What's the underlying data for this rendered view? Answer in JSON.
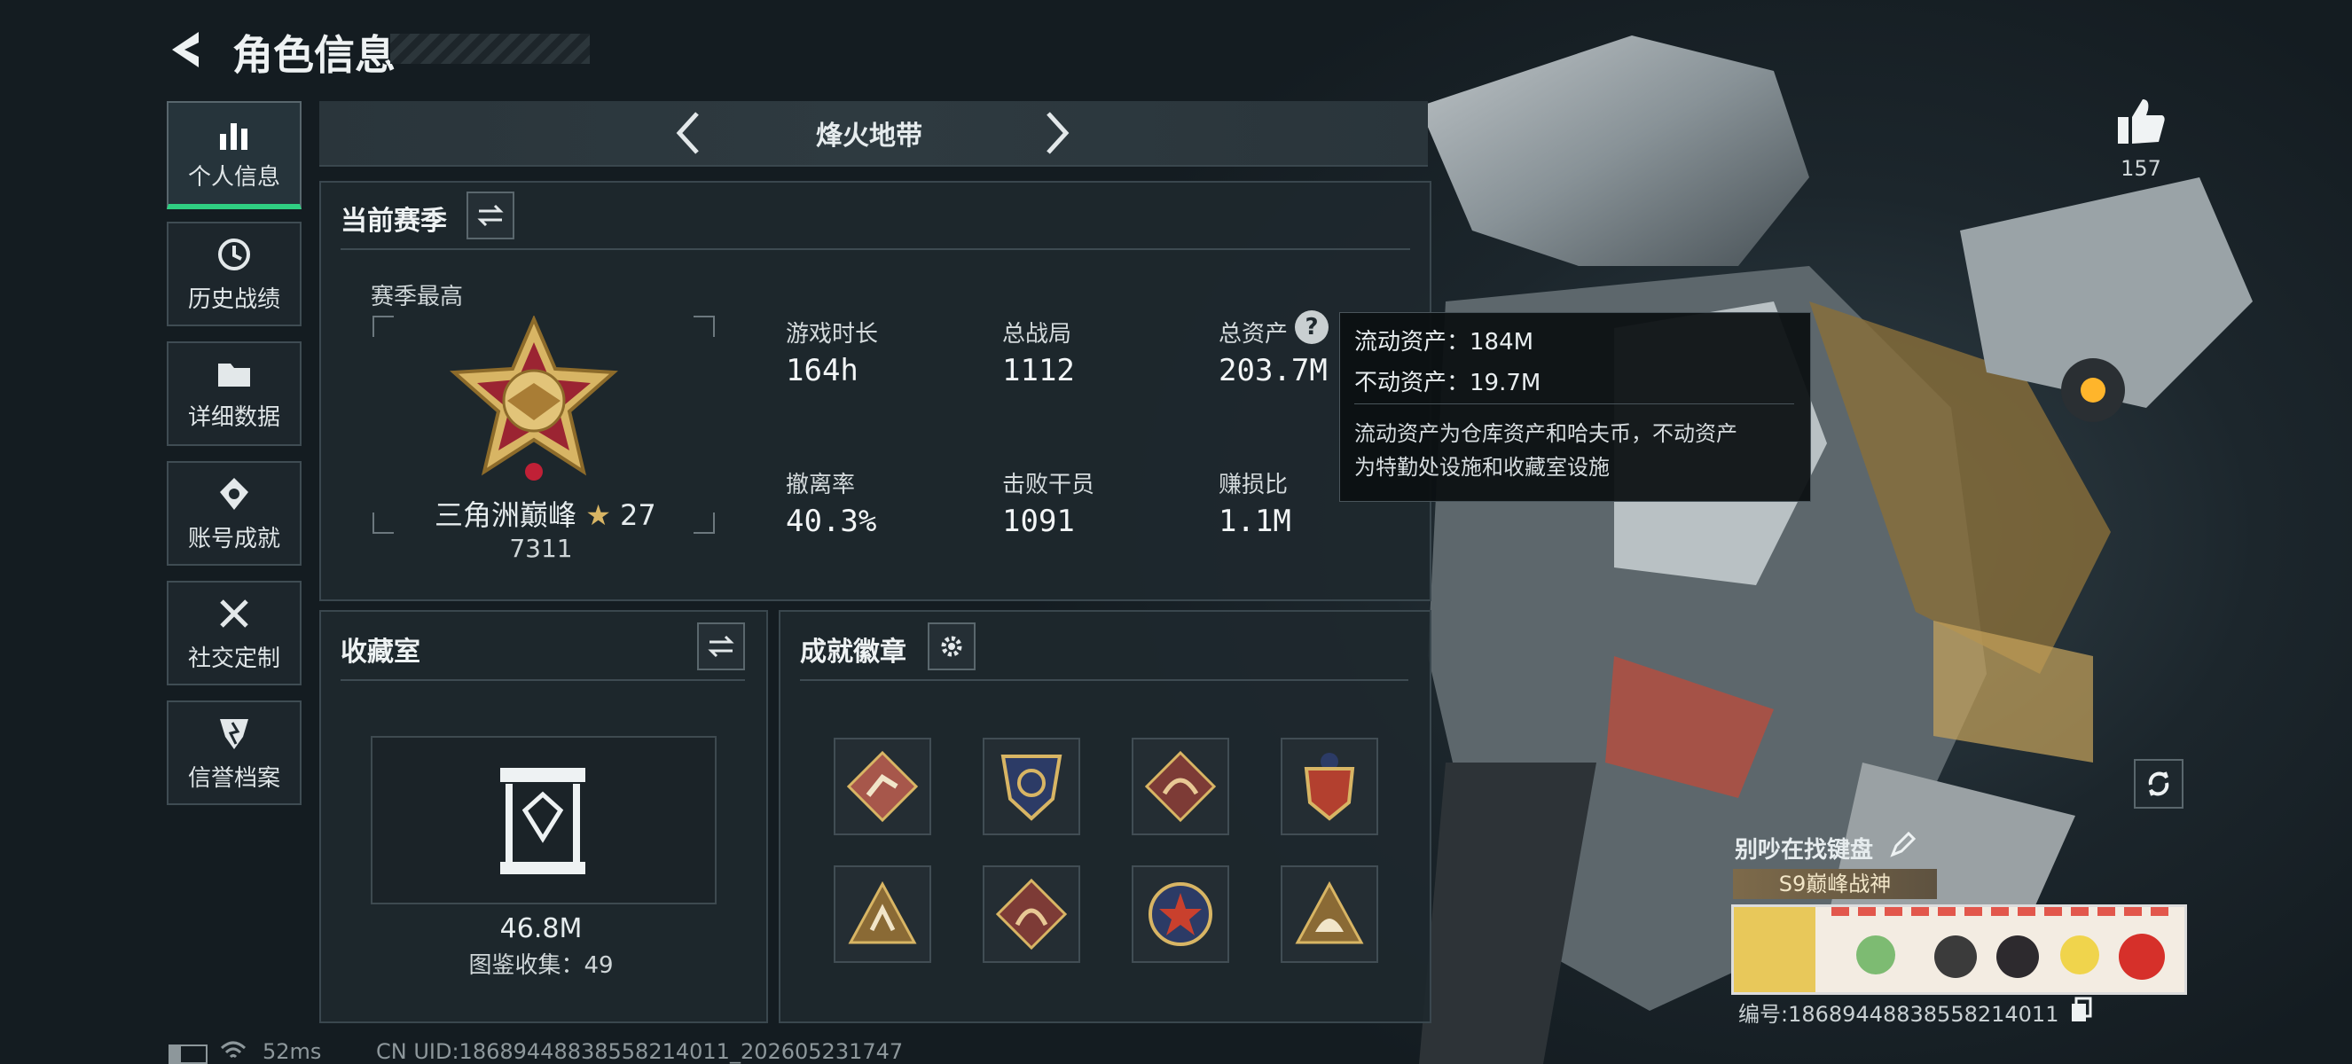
{
  "header": {
    "title": "角色信息"
  },
  "sidebar": {
    "items": [
      {
        "label": "个人信息",
        "icon": "bar-chart-icon",
        "active": true
      },
      {
        "label": "历史战绩",
        "icon": "history-clock-icon"
      },
      {
        "label": "详细数据",
        "icon": "folder-icon"
      },
      {
        "label": "账号成就",
        "icon": "achievement-icon"
      },
      {
        "label": "社交定制",
        "icon": "tools-icon"
      },
      {
        "label": "信誉档案",
        "icon": "shield-icon"
      }
    ]
  },
  "mode_selector": {
    "label": "烽火地带",
    "prev_icon": "chevron-left-icon",
    "next_icon": "chevron-right-icon"
  },
  "season": {
    "title": "当前赛季",
    "best_label": "赛季最高",
    "rank_name": "三角洲巅峰",
    "rank_stars": "27",
    "rank_points": "7311",
    "stats": [
      {
        "label": "游戏时长",
        "value": "164h"
      },
      {
        "label": "总战局",
        "value": "1112"
      },
      {
        "label": "总资产",
        "value": "203.7M"
      },
      {
        "label": "撤离率",
        "value": "40.3%"
      },
      {
        "label": "击败干员",
        "value": "1091"
      },
      {
        "label": "赚损比",
        "value": "1.1M"
      }
    ]
  },
  "tooltip": {
    "liquid": "流动资产：184M",
    "fixed": "不动资产：19.7M",
    "desc_line1": "流动资产为仓库资产和哈夫币，不动资产",
    "desc_line2": "为特勤处设施和收藏室设施"
  },
  "collection": {
    "title": "收藏室",
    "value": "46.8M",
    "count_label": "图鉴收集：49"
  },
  "badges": {
    "title": "成就徽章"
  },
  "likes": {
    "count": "157"
  },
  "player": {
    "name": "别吵在找键盘",
    "title_tag": "S9巅峰战神",
    "id_text": "编号:18689448838558214011"
  },
  "footer": {
    "ping": "52ms",
    "uid": "CN UID:18689448838558214011_202605231747"
  },
  "colors": {
    "accent": "#2fcf82",
    "gold": "#d8b564",
    "panel_bg": "#1e282e"
  }
}
